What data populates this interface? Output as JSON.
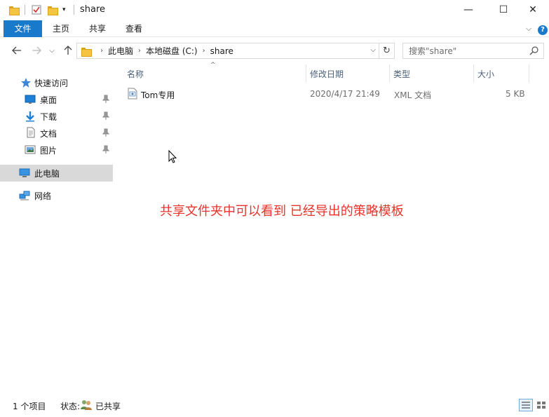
{
  "window": {
    "title": "share",
    "controls": {
      "minimize": "—",
      "maximize": "☐",
      "close": "✕"
    }
  },
  "ribbon": {
    "tabs": [
      "文件",
      "主页",
      "共享",
      "查看"
    ],
    "active_tab": "文件",
    "help_glyph": "?"
  },
  "nav": {
    "breadcrumb": [
      "此电脑",
      "本地磁盘 (C:)",
      "share"
    ],
    "search_placeholder": "搜索\"share\""
  },
  "sidebar": {
    "quick_access": "快速访问",
    "items": [
      {
        "label": "桌面",
        "icon": "desktop-icon",
        "pinned": true
      },
      {
        "label": "下载",
        "icon": "download-icon",
        "pinned": true
      },
      {
        "label": "文档",
        "icon": "document-icon",
        "pinned": true
      },
      {
        "label": "图片",
        "icon": "pictures-icon",
        "pinned": true
      }
    ],
    "this_pc": "此电脑",
    "network": "网络"
  },
  "file_list": {
    "columns": [
      "名称",
      "修改日期",
      "类型",
      "大小"
    ],
    "files": [
      {
        "name": "Tom专用",
        "modified": "2020/4/17 21:49",
        "type": "XML 文档",
        "size": "5 KB"
      }
    ]
  },
  "annotation": "共享文件夹中可以看到 已经导出的策略模板",
  "status": {
    "item_count": "1 个项目",
    "state_label": "状态:",
    "state_value": "已共享"
  },
  "colors": {
    "accent": "#1979ca",
    "annotation": "#e8322a",
    "selection": "#d9d9d9"
  }
}
